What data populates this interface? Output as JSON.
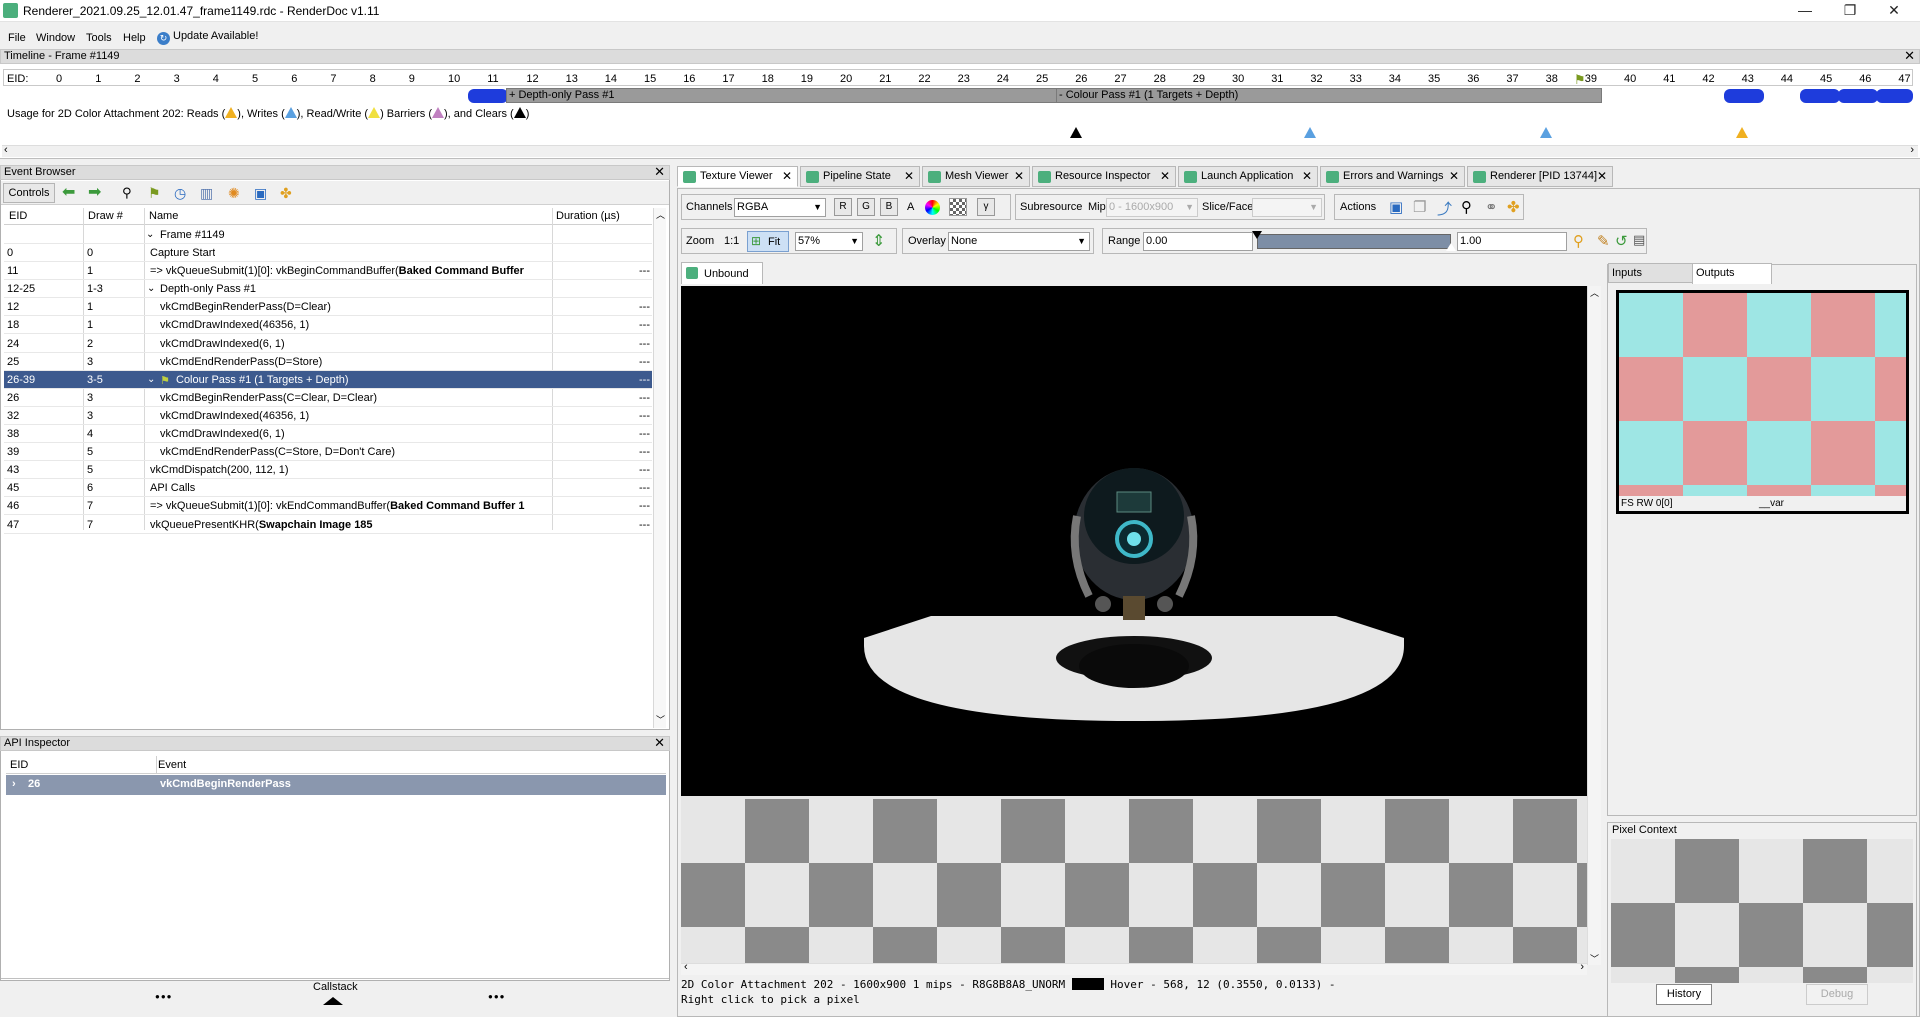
{
  "window": {
    "title": "Renderer_2021.09.25_12.01.47_frame1149.rdc - RenderDoc v1.11",
    "minimize": "—",
    "maximize": "❐",
    "close": "✕"
  },
  "menu": {
    "file": "File",
    "window": "Window",
    "tools": "Tools",
    "help": "Help",
    "update": "Update Available!"
  },
  "timeline": {
    "title": "Timeline - Frame #1149",
    "eid_label": "EID:",
    "ticks": [
      "0",
      "1",
      "2",
      "3",
      "4",
      "5",
      "6",
      "7",
      "8",
      "9",
      "10",
      "11",
      "12",
      "13",
      "14",
      "15",
      "16",
      "17",
      "18",
      "19",
      "20",
      "21",
      "22",
      "23",
      "24",
      "25",
      "26",
      "27",
      "28",
      "29",
      "30",
      "31",
      "32",
      "33",
      "34",
      "35",
      "36",
      "37",
      "38",
      "39",
      "40",
      "41",
      "42",
      "43",
      "44",
      "45",
      "46",
      "47"
    ],
    "depth_pass": "+ Depth-only Pass #1",
    "colour_pass": "- Colour Pass #1 (1 Targets + Depth)",
    "usage_text": "Usage for 2D Color Attachment 202: Reads (",
    "usage_writes": "), Writes (",
    "usage_rw": "), Read/Write (",
    "usage_barriers": ") Barriers (",
    "usage_clears": "), and Clears (",
    "usage_end": ")"
  },
  "event_browser": {
    "title": "Event Browser",
    "controls": "Controls",
    "columns": {
      "eid": "EID",
      "draw": "Draw #",
      "name": "Name",
      "duration": "Duration (µs)"
    },
    "frame_label": "Frame #1149",
    "rows": [
      {
        "eid": "0",
        "draw": "0",
        "name": "Capture Start",
        "dur": ""
      },
      {
        "eid": "11",
        "draw": "1",
        "name": "=> vkQueueSubmit(1)[0]: vkBeginCommandBuffer(",
        "bold": "Baked Command Buffer",
        "dur": "---"
      },
      {
        "eid": "12-25",
        "draw": "1-3",
        "name": "Depth-only Pass #1",
        "dur": ""
      },
      {
        "eid": "12",
        "draw": "1",
        "name": "vkCmdBeginRenderPass(D=Clear)",
        "dur": "---"
      },
      {
        "eid": "18",
        "draw": "1",
        "name": "vkCmdDrawIndexed(46356, 1)",
        "dur": "---"
      },
      {
        "eid": "24",
        "draw": "2",
        "name": "vkCmdDrawIndexed(6, 1)",
        "dur": "---"
      },
      {
        "eid": "25",
        "draw": "3",
        "name": "vkCmdEndRenderPass(D=Store)",
        "dur": "---"
      },
      {
        "eid": "26-39",
        "draw": "3-5",
        "name": "Colour Pass #1 (1 Targets + Depth)",
        "dur": "---"
      },
      {
        "eid": "26",
        "draw": "3",
        "name": "vkCmdBeginRenderPass(C=Clear, D=Clear)",
        "dur": "---"
      },
      {
        "eid": "32",
        "draw": "3",
        "name": "vkCmdDrawIndexed(46356, 1)",
        "dur": "---"
      },
      {
        "eid": "38",
        "draw": "4",
        "name": "vkCmdDrawIndexed(6, 1)",
        "dur": "---"
      },
      {
        "eid": "39",
        "draw": "5",
        "name": "vkCmdEndRenderPass(C=Store, D=Don't Care)",
        "dur": "---"
      },
      {
        "eid": "43",
        "draw": "5",
        "name": "vkCmdDispatch(200, 112, 1)",
        "dur": "---"
      },
      {
        "eid": "45",
        "draw": "6",
        "name": "API Calls",
        "dur": "---"
      },
      {
        "eid": "46",
        "draw": "7",
        "name": "=> vkQueueSubmit(1)[0]: vkEndCommandBuffer(",
        "bold": "Baked Command Buffer 1",
        "dur": "---"
      },
      {
        "eid": "47",
        "draw": "7",
        "name": "vkQueuePresentKHR(",
        "bold": "Swapchain Image 185",
        "dur": "---"
      }
    ]
  },
  "api_inspector": {
    "title": "API Inspector",
    "col_eid": "EID",
    "col_event": "Event",
    "row_eid": "26",
    "row_event": "vkCmdBeginRenderPass",
    "callstack": "Callstack",
    "dots": "●●●"
  },
  "tabs": [
    "Texture Viewer",
    "Pipeline State",
    "Mesh Viewer",
    "Resource Inspector",
    "Launch Application",
    "Errors and Warnings",
    "Renderer [PID 13744]"
  ],
  "texture_viewer": {
    "channels_label": "Channels",
    "channels_value": "RGBA",
    "r": "R",
    "g": "G",
    "b": "B",
    "a": "A",
    "gamma": "γ",
    "subresource_label": "Subresource",
    "mip_label": "Mip",
    "mip_value": "0 - 1600x900",
    "slice_label": "Slice/Face",
    "actions_label": "Actions",
    "zoom_label": "Zoom",
    "zoom_11": "1:1",
    "fit": "Fit",
    "zoom_value": "57%",
    "overlay_label": "Overlay",
    "overlay_value": "None",
    "range_label": "Range",
    "range_min": "0.00",
    "range_max": "1.00",
    "unbound_tab": "Unbound",
    "inputs_tab": "Inputs",
    "outputs_tab": "Outputs",
    "thumb_caption_left": "FS RW 0[0]",
    "thumb_caption_right": "__var",
    "status_line1": "2D Color Attachment 202 - 1600x900 1 mips - R8G8B8A8_UNORM",
    "status_hover": "Hover -   568,   12 (0.3550, 0.0133)  -",
    "status_line2": "Right click to pick a pixel",
    "pixel_context": "Pixel Context",
    "history": "History",
    "debug": "Debug"
  }
}
